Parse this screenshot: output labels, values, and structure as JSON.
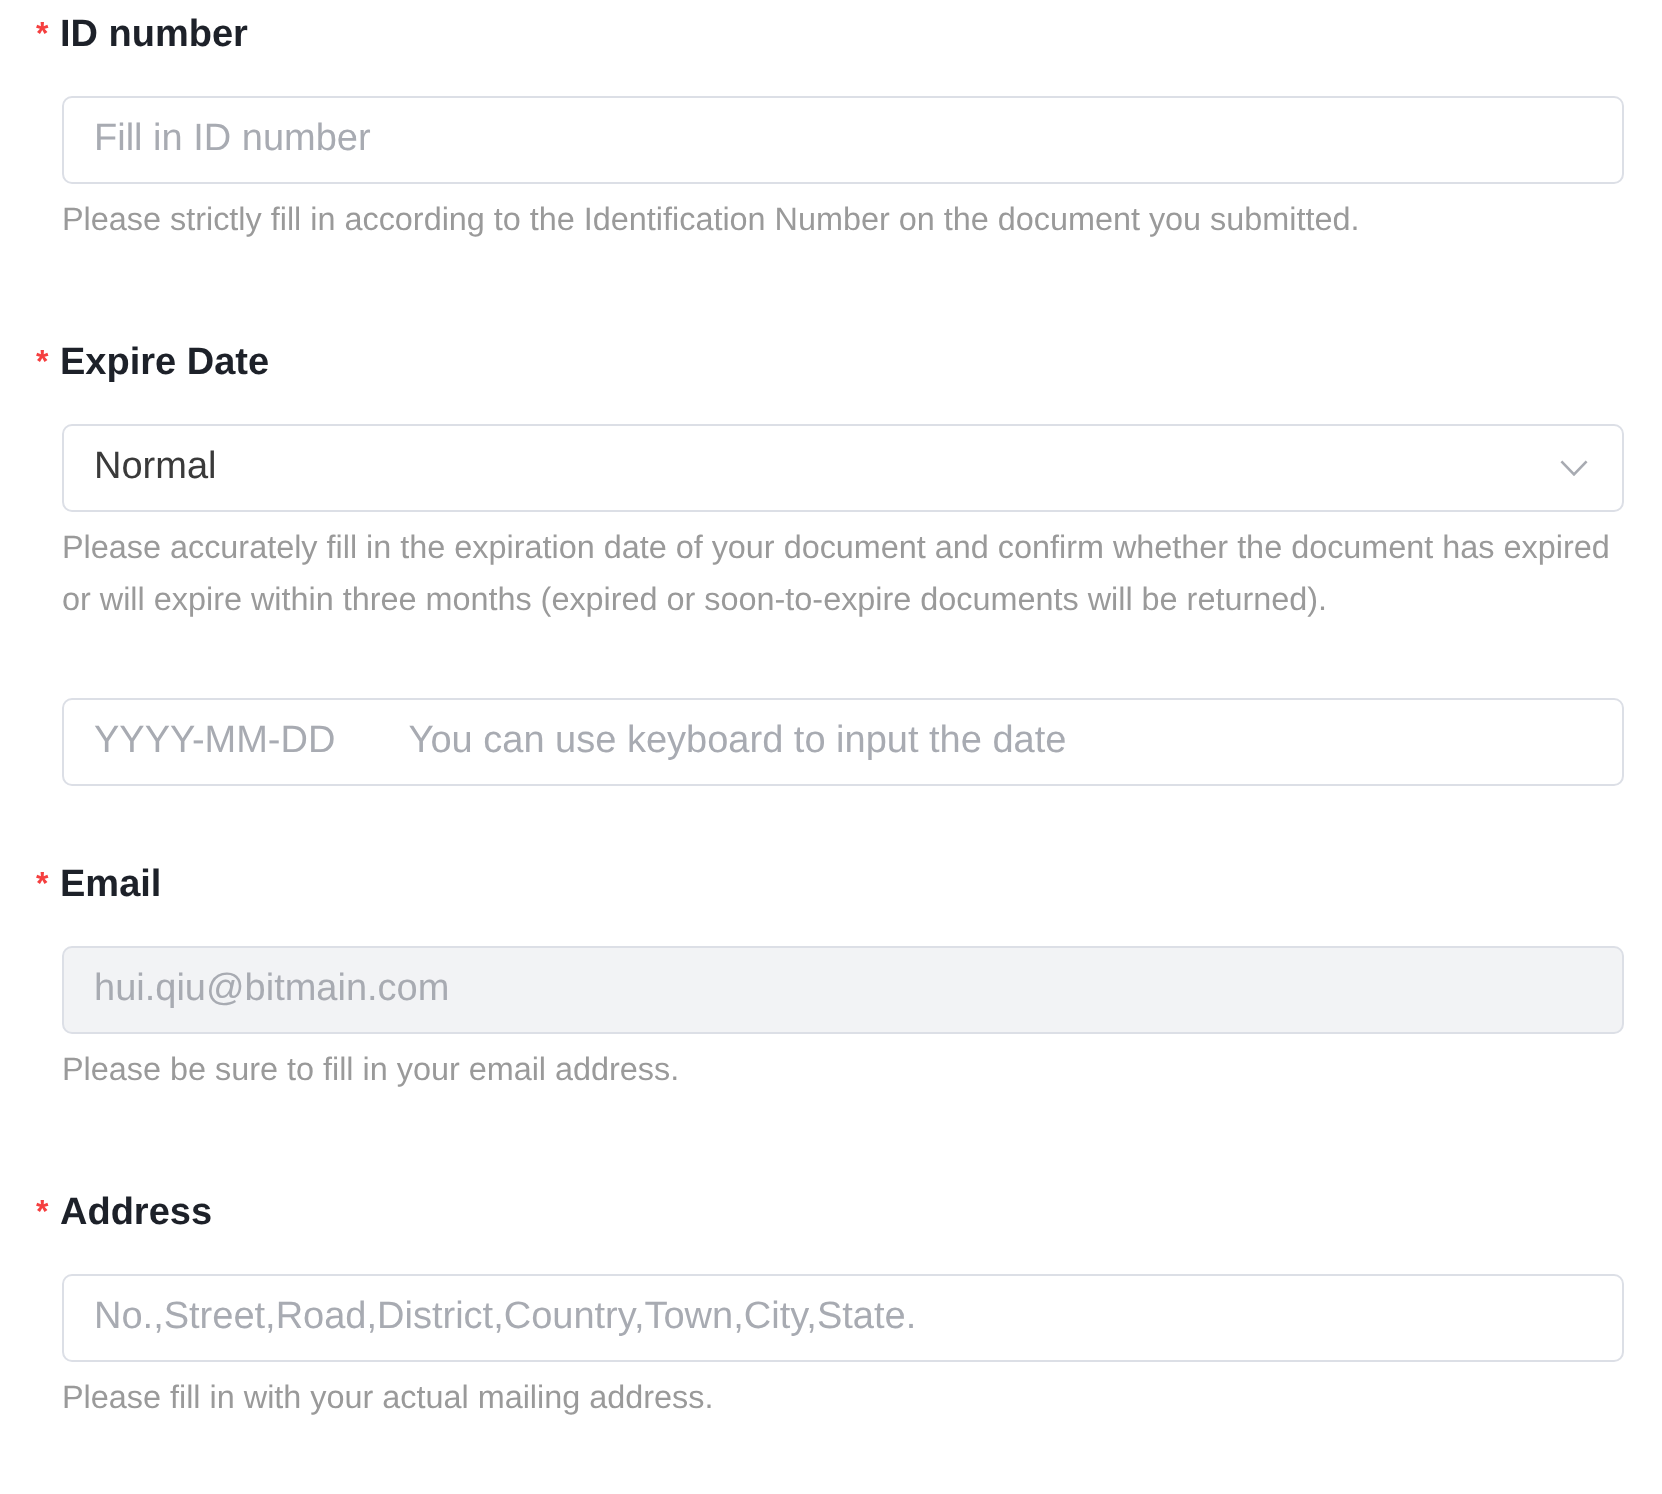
{
  "fields": [
    {
      "required_mark": "*",
      "label": "ID number",
      "controls": [
        {
          "kind": "text",
          "placeholder": "Fill in ID number",
          "disabled": false,
          "help": "Please strictly fill in according to the Identification Number on the document you submitted."
        }
      ]
    },
    {
      "required_mark": "*",
      "label": "Expire Date",
      "controls": [
        {
          "kind": "select",
          "value": "Normal",
          "disabled": false,
          "help": "Please accurately fill in the expiration date of your document and confirm whether the document has expired or will expire within three months (expired or soon-to-expire documents will be returned)."
        },
        {
          "kind": "text",
          "placeholder": "YYYY-MM-DD       You can use keyboard to input the date",
          "disabled": false
        }
      ]
    },
    {
      "required_mark": "*",
      "label": "Email",
      "controls": [
        {
          "kind": "text",
          "value": "hui.qiu@bitmain.com",
          "disabled": true,
          "help": "Please be sure to fill in your email address."
        }
      ]
    },
    {
      "required_mark": "*",
      "label": "Address",
      "controls": [
        {
          "kind": "text",
          "placeholder": "No.,Street,Road,District,Country,Town,City,State.",
          "disabled": false,
          "help": "Please fill in with your actual mailing address."
        }
      ]
    }
  ]
}
